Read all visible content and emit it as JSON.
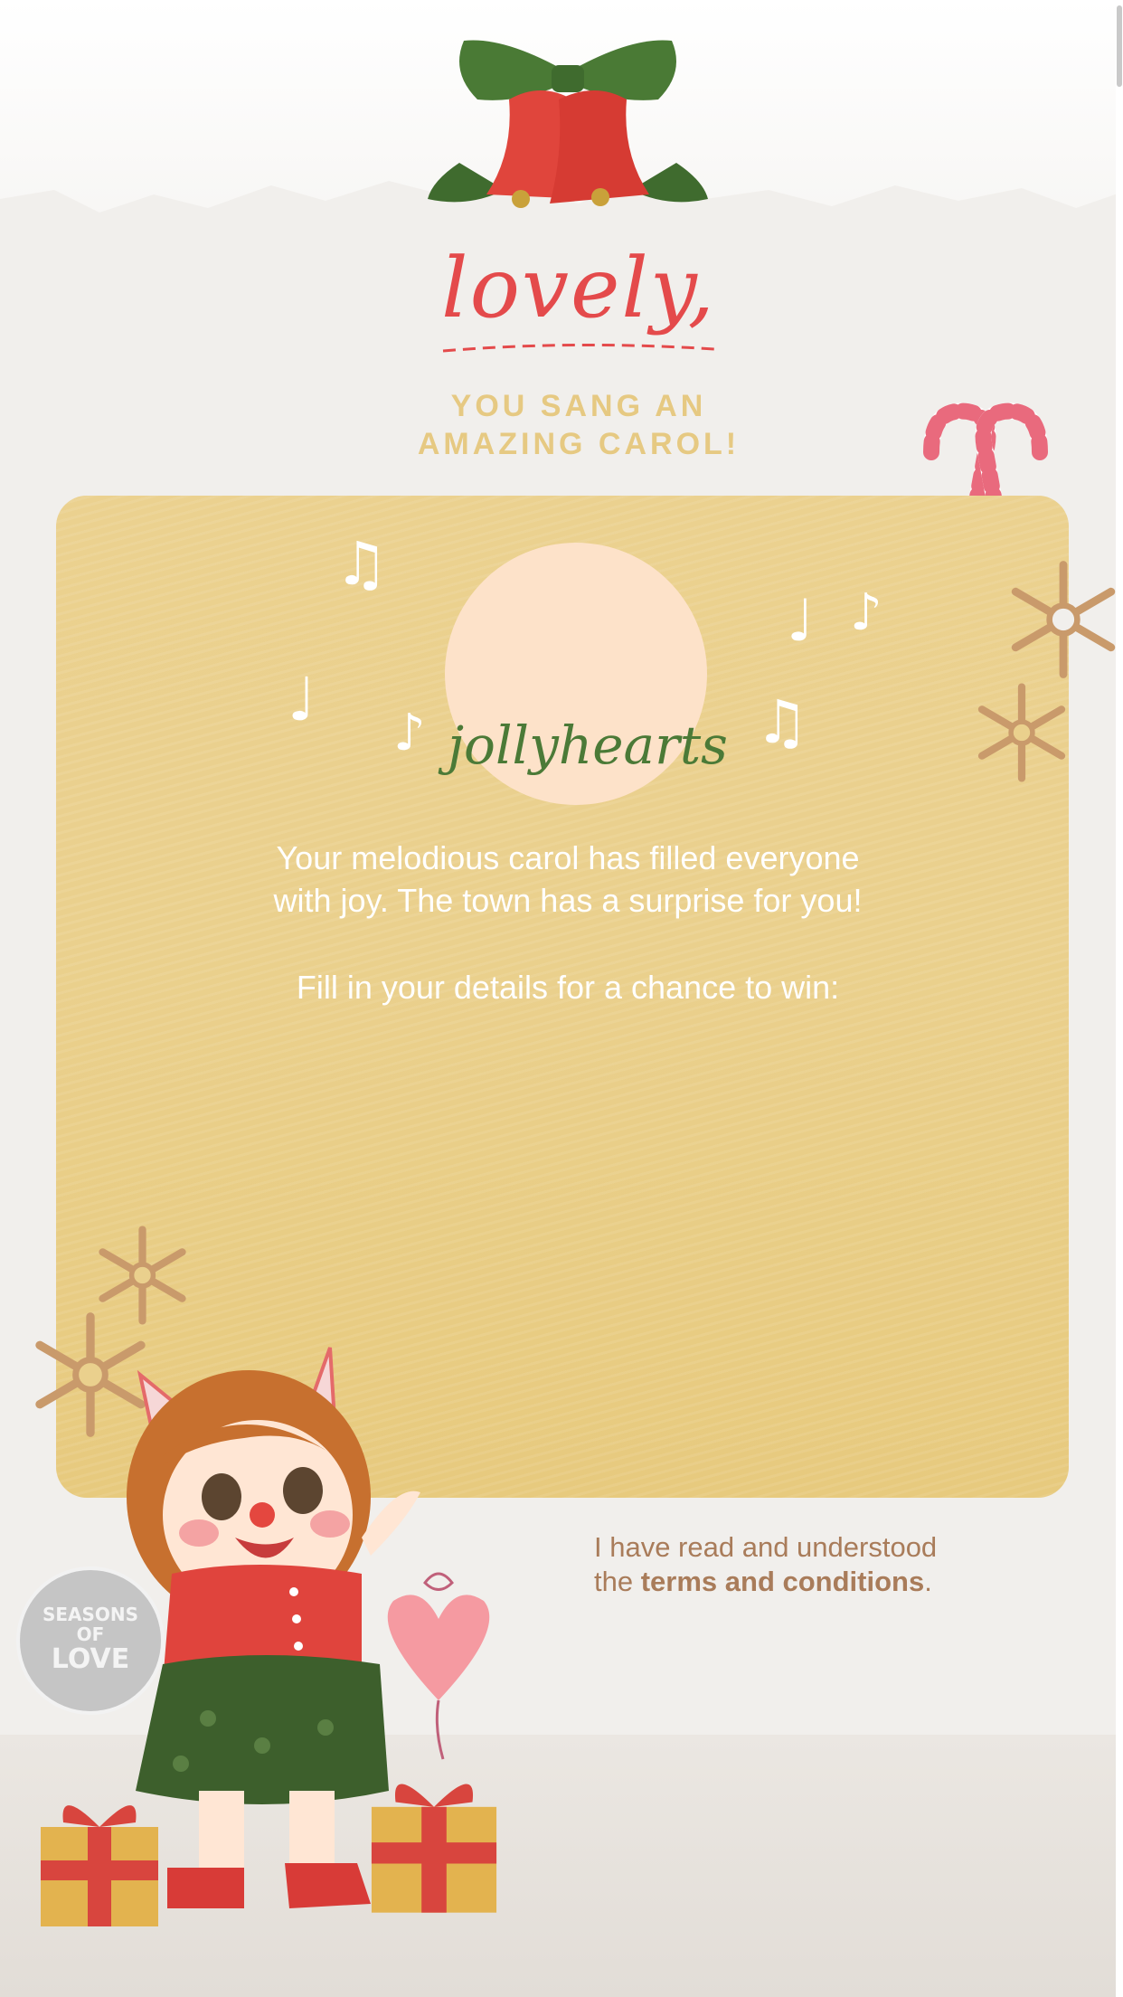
{
  "header": {
    "script_title": "lovely,",
    "subtitle_line1": "YOU SANG AN",
    "subtitle_line2": "AMAZING CAROL!"
  },
  "card": {
    "logo_text": "jollyhearts",
    "message_line1": "Your melodious carol has filled everyone",
    "message_line2": "with joy. The town has a surprise for you!",
    "prompt": "Fill in your details for a chance to win:"
  },
  "terms": {
    "prefix_line1": "I have read and understood",
    "prefix_line2": "the ",
    "link_label": "terms and conditions",
    "suffix": "."
  },
  "badge": {
    "line1": "SEASONS",
    "line2": "OF",
    "line3": "LOVE"
  },
  "icons": {
    "bell": "bell-icon",
    "candy_cane": "candy-cane-icon",
    "snowflake": "snowflake-icon",
    "music_note": "music-note-icon",
    "gift": "gift-icon",
    "heart_balloon": "heart-balloon-icon",
    "girl": "caroling-girl-illustration"
  },
  "colors": {
    "card": "#ead08d",
    "title_red": "#e44a4b",
    "subtitle_gold": "#e6c982",
    "terms_brown": "#a97c5a",
    "logo_green": "#4b7a37"
  }
}
